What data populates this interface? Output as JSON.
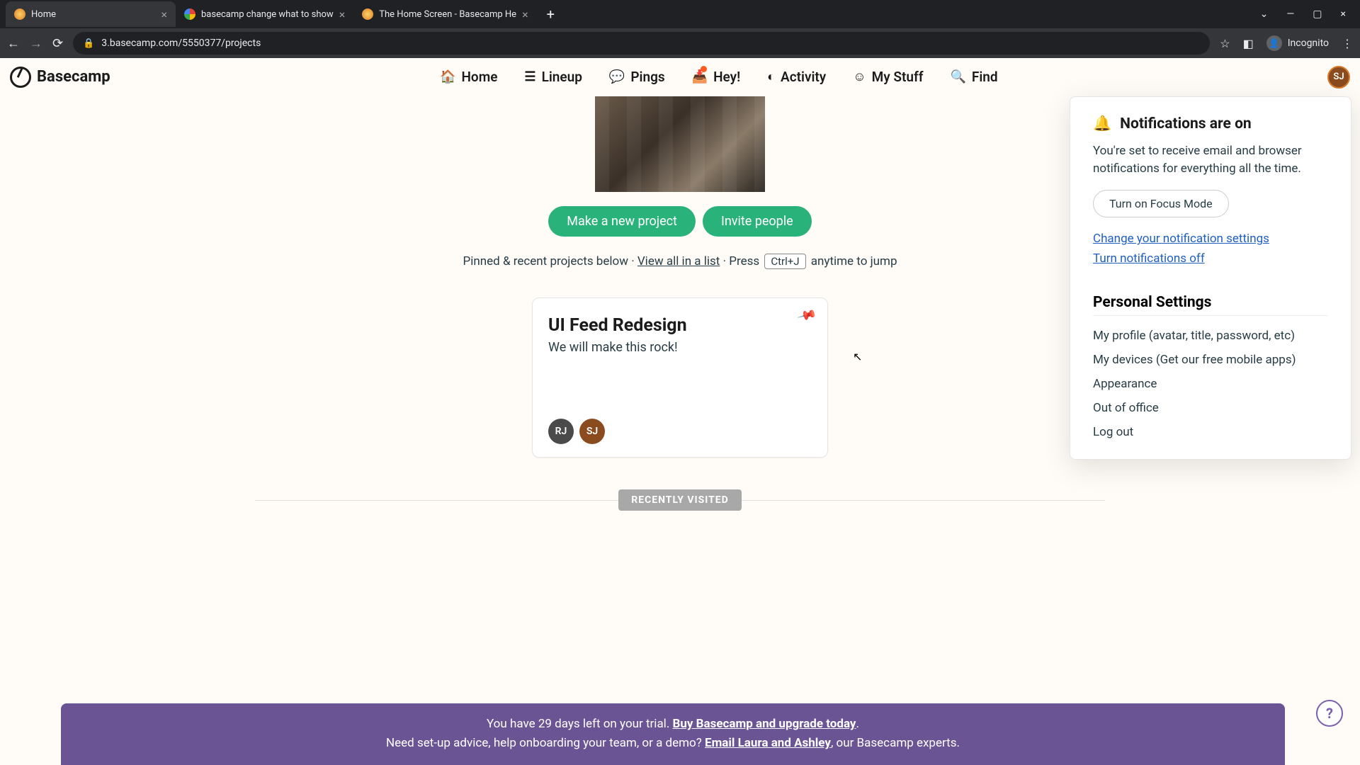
{
  "browser": {
    "tabs": [
      {
        "title": "Home",
        "favicon_color": "#f4b400"
      },
      {
        "title": "basecamp change what to show",
        "favicon_color": "#fff"
      },
      {
        "title": "The Home Screen - Basecamp He",
        "favicon_color": "#f4b400"
      }
    ],
    "url": "3.basecamp.com/5550377/projects",
    "incognito_label": "Incognito"
  },
  "logo_text": "Basecamp",
  "nav": {
    "home": "Home",
    "lineup": "Lineup",
    "pings": "Pings",
    "hey": "Hey!",
    "activity": "Activity",
    "mystuff": "My Stuff",
    "find": "Find"
  },
  "avatar_initials": "SJ",
  "actions": {
    "new_project": "Make a new project",
    "invite": "Invite people"
  },
  "hint": {
    "prefix": "Pinned & recent projects below · ",
    "view_all": "View all in a list",
    "press": " · Press ",
    "shortcut": "Ctrl+J",
    "suffix": " anytime to jump"
  },
  "project": {
    "title": "UI Feed Redesign",
    "desc": "We will make this rock!",
    "avatars": [
      {
        "initials": "RJ",
        "cls": "rj"
      },
      {
        "initials": "SJ",
        "cls": "sj"
      }
    ]
  },
  "recently_visited_label": "RECENTLY VISITED",
  "dropdown": {
    "notif_heading": "Notifications are on",
    "notif_text": "You're set to receive email and browser notifications for everything all the time.",
    "focus_btn": "Turn on Focus Mode",
    "change_link": "Change your notification settings",
    "off_link": "Turn notifications off",
    "personal_heading": "Personal Settings",
    "items": {
      "profile": "My profile (avatar, title, password, etc)",
      "devices": "My devices (Get our free mobile apps)",
      "appearance": "Appearance",
      "ooo": "Out of office",
      "logout": "Log out"
    }
  },
  "trial": {
    "line1_prefix": "You have 29 days left on your trial. ",
    "line1_link": "Buy Basecamp and upgrade today",
    "line1_suffix": ".",
    "line2_prefix": "Need set-up advice, help onboarding your team, or a demo? ",
    "line2_link": "Email Laura and Ashley",
    "line2_suffix": ", our Basecamp experts."
  },
  "help_label": "?"
}
